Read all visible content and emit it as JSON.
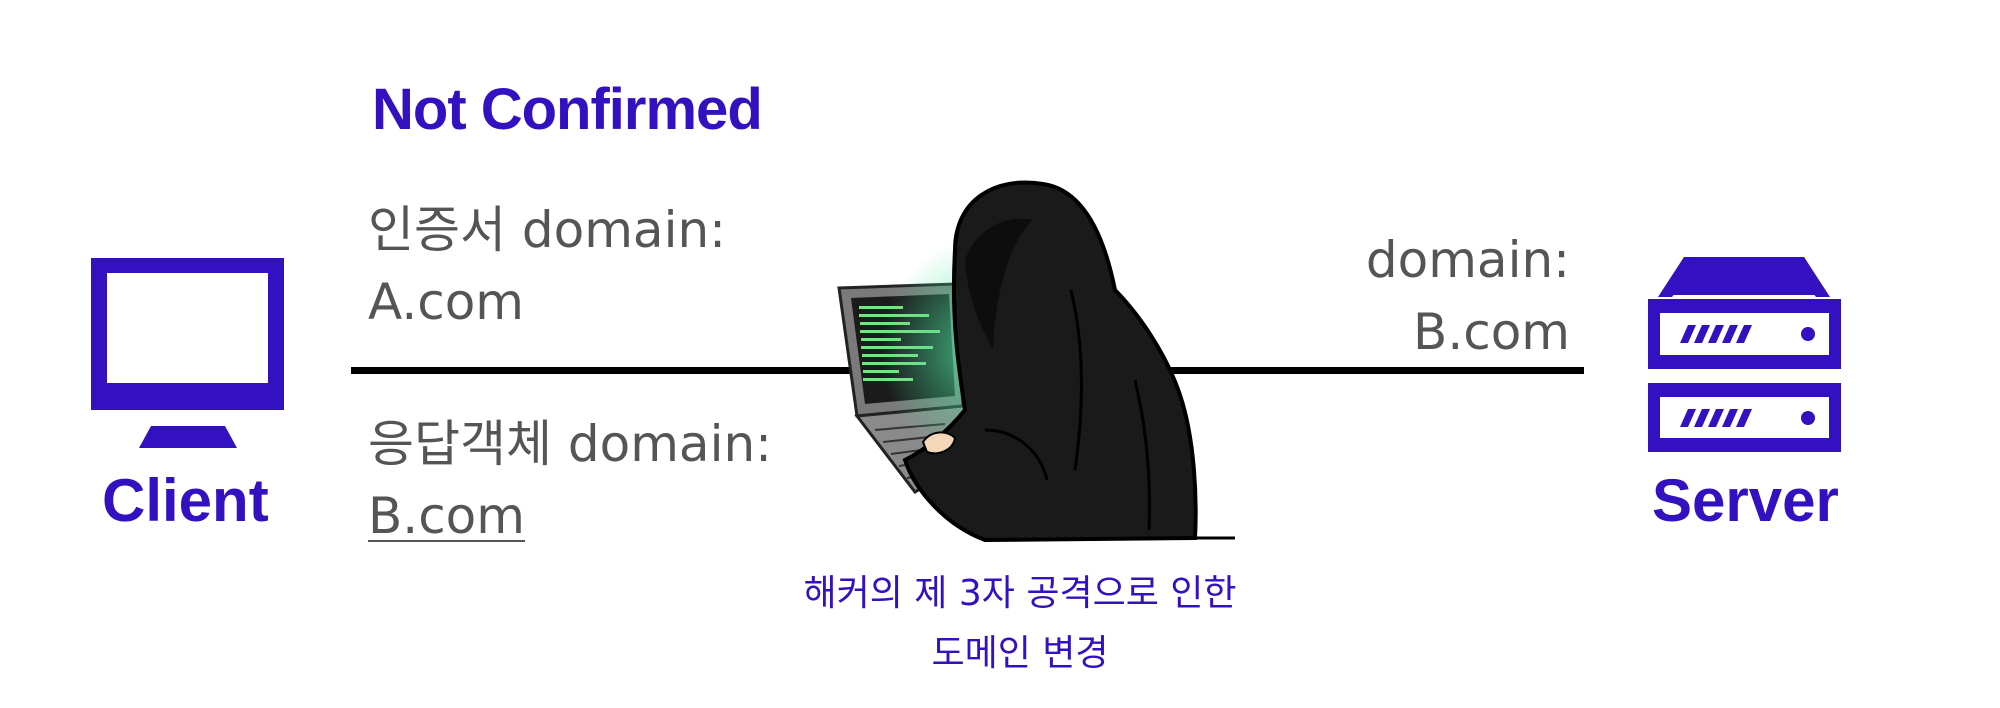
{
  "status_title": "Not Confirmed",
  "certificate": {
    "label": "인증서 domain:",
    "value": "A.com"
  },
  "response": {
    "label": "응답객체 domain:",
    "value": "B.com"
  },
  "server_domain": {
    "label": "domain:",
    "value": "B.com"
  },
  "client_label": "Client",
  "server_label": "Server",
  "caption": {
    "line1": "해커의 제 3자 공격으로 인한",
    "line2": "도메인 변경"
  },
  "colors": {
    "accent": "#3310c0",
    "text_gray": "#555555",
    "line": "#000000"
  },
  "icons": [
    "monitor-icon",
    "server-icon",
    "hacker-illustration"
  ]
}
